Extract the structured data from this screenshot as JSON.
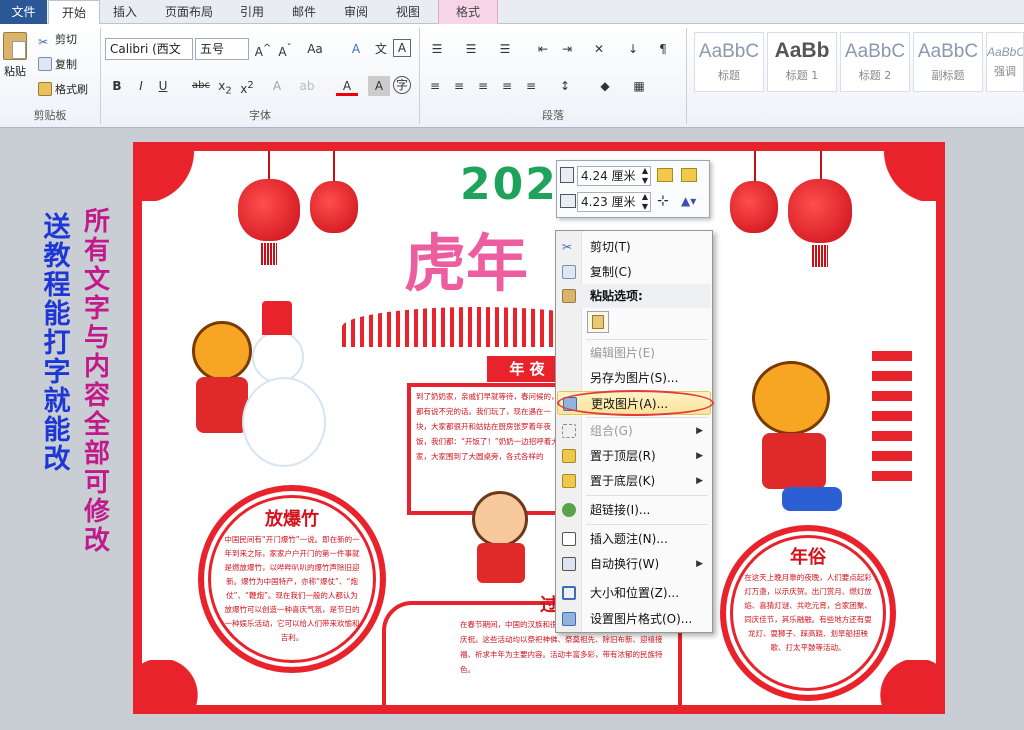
{
  "tabs": [
    "文件",
    "开始",
    "插入",
    "页面布局",
    "引用",
    "邮件",
    "审阅",
    "视图",
    "格式"
  ],
  "clipboard": {
    "paste": "粘贴",
    "cut": "剪切",
    "copy": "复制",
    "format_painter": "格式刷",
    "group": "剪贴板"
  },
  "font": {
    "name": "Calibri (西文",
    "size": "五号",
    "group": "字体"
  },
  "paragraph": {
    "group": "段落"
  },
  "styles": [
    {
      "sample": "AaBbC",
      "label": "标题"
    },
    {
      "sample": "AaBb",
      "label": "标题 1"
    },
    {
      "sample": "AaBbC",
      "label": "标题 2"
    },
    {
      "sample": "AaBbC",
      "label": "副标题"
    },
    {
      "sample": "AaBbC",
      "label": "强调"
    }
  ],
  "poster": {
    "promo_left": "送教程 能打字就能改",
    "promo_right": "所有文字与内容全部可修改",
    "title_year": "202",
    "title_main": "虎年",
    "banner_small": "年 夜",
    "left_title": "放爆竹",
    "left_text": "中国民间有“开门爆竹”一说。即在新的一年到来之际，家家户户开门的第一件事就是燃放爆竹，以哔哔叭叭的爆竹声除旧迎新。爆竹为中国特产，亦称“爆仗”、“炮仗”、“鞭炮”。现在我们一般的人都认为放爆竹可以创造一种喜庆气氛，是节日的一种娱乐活动，它可以给人们带来欢愉和吉利。",
    "right_title": "年俗",
    "right_text": "在这天上晚月靠的夜晚，人们要点起彩灯万盏，以示庆贺。出门赏月、燃灯放焰、喜猜灯谜、共吃元宵，合家团聚、同庆佳节，其乐融融。有些地方还有耍龙灯、耍狮子、踩高跷、划旱船扭秧歌、打太平鼓等活动。",
    "center_text": "到了奶奶家，亲戚们早就等待，春问候的，都有说不完的话。我们玩了，现在遇在一块，大家都很开和姑姑在厨房张罗着年夜饭，我们都：“开饭了！”奶奶一边招呼着大家，大家围到了大圆桌旁，各式各样的",
    "bottom_title": "过",
    "bottom_text": "在春节期间，中国的汉族和很多少数民族都要举行各种活动以示庆祝。这些活动均以祭祀神佛、祭奠祖先、除旧布新、迎禧接福、祈求丰年为主要内容。活动丰富多彩，带有浓郁的民族特色。"
  },
  "size_bar": {
    "height": "4.24 厘米",
    "width": "4.23 厘米"
  },
  "context_menu": {
    "items": [
      {
        "label": "剪切(T)",
        "icon": "scissors-icon"
      },
      {
        "label": "复制(C)",
        "icon": "copy-icon"
      },
      {
        "label": "粘贴选项:",
        "icon": "paste-icon"
      },
      {
        "label": "编辑图片(E)",
        "icon": ""
      },
      {
        "label": "另存为图片(S)...",
        "icon": ""
      },
      {
        "label": "更改图片(A)...",
        "icon": "change-picture-icon"
      },
      {
        "label": "组合(G)",
        "icon": "group-icon"
      },
      {
        "label": "置于顶层(R)",
        "icon": "bring-front-icon"
      },
      {
        "label": "置于底层(K)",
        "icon": "send-back-icon"
      },
      {
        "label": "超链接(I)...",
        "icon": "hyperlink-icon"
      },
      {
        "label": "插入题注(N)...",
        "icon": "caption-icon"
      },
      {
        "label": "自动换行(W)",
        "icon": "wrap-icon"
      },
      {
        "label": "大小和位置(Z)...",
        "icon": "size-icon"
      },
      {
        "label": "设置图片格式(O)...",
        "icon": "format-picture-icon"
      }
    ]
  }
}
